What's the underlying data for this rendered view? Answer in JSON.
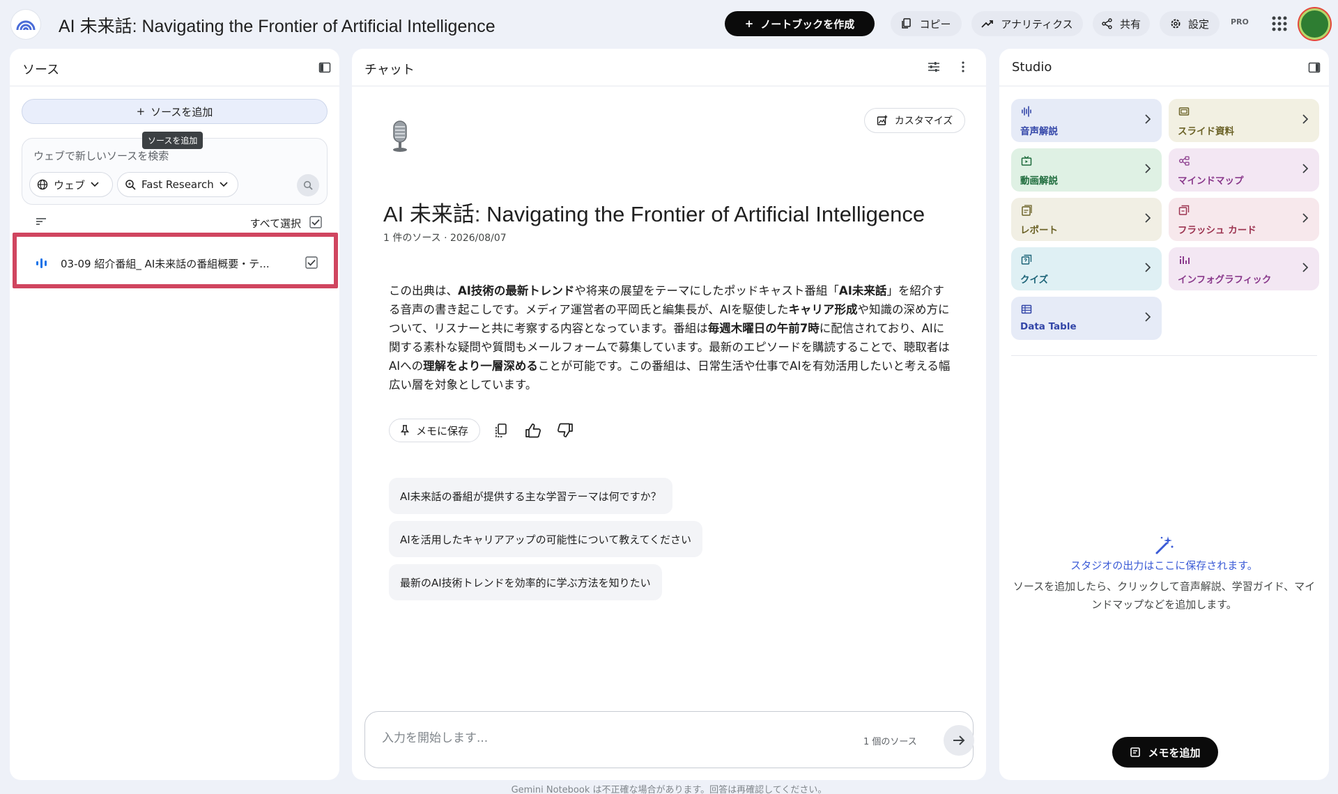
{
  "header": {
    "title": "AI 未来話: Navigating the Frontier of Artificial Intelligence",
    "create_notebook": "ノートブックを作成",
    "copy": "コピー",
    "analytics": "アナリティクス",
    "share": "共有",
    "settings": "設定",
    "plan_badge": "PRO"
  },
  "sources": {
    "title": "ソース",
    "add_source": "ソースを追加",
    "tooltip": "ソースを追加",
    "search_placeholder": "ウェブで新しいソースを検索",
    "web_chip": "ウェブ",
    "research_chip": "Fast Research",
    "select_all": "すべて選択",
    "items": [
      {
        "name": "03-09 紹介番組_ AI未来話の番組概要・テ...",
        "checked": true
      }
    ]
  },
  "chat": {
    "title": "チャット",
    "customize": "カスタマイズ",
    "notebook_title": "AI 未来話: Navigating the Frontier of Artificial Intelligence",
    "meta": "1 件のソース · 2026/08/07",
    "summary_parts": [
      {
        "text": "この出典は、",
        "bold": false
      },
      {
        "text": "AI技術の最新トレンド",
        "bold": true
      },
      {
        "text": "や将来の展望をテーマにしたポッドキャスト番組「",
        "bold": false
      },
      {
        "text": "AI未来話",
        "bold": true
      },
      {
        "text": "」を紹介する音声の書き起こしです。メディア運営者の平岡氏と編集長が、AIを駆使した",
        "bold": false
      },
      {
        "text": "キャリア形成",
        "bold": true
      },
      {
        "text": "や知識の深め方について、リスナーと共に考察する内容となっています。番組は",
        "bold": false
      },
      {
        "text": "毎週木曜日の午前7時",
        "bold": true
      },
      {
        "text": "に配信されており、AIに関する素朴な疑問や質問もメールフォームで募集しています。最新のエピソードを購読することで、聴取者はAIへの",
        "bold": false
      },
      {
        "text": "理解をより一層深める",
        "bold": true
      },
      {
        "text": "ことが可能です。この番組は、日常生活や仕事でAIを有効活用したいと考える幅広い層を対象としています。",
        "bold": false
      }
    ],
    "save_to_memo": "メモに保存",
    "suggestions": [
      "AI未来話の番組が提供する主な学習テーマは何ですか？",
      "AIを活用したキャリアアップの可能性について教えてください",
      "最新のAI技術トレンドを効率的に学ぶ方法を知りたい"
    ],
    "input_placeholder": "入力を開始します...",
    "source_count": "1 個のソース",
    "footer": "Gemini Notebook は不正確な場合があります。回答は再確認してください。"
  },
  "studio": {
    "title": "Studio",
    "tiles": [
      {
        "label": "音声解説",
        "icon": "audio-wave-icon",
        "bg": "#e6ebf7",
        "color": "#3346a8"
      },
      {
        "label": "スライド資料",
        "icon": "slides-icon",
        "bg": "#f2f0e2",
        "color": "#6b6227"
      },
      {
        "label": "動画解説",
        "icon": "video-icon",
        "bg": "#dff1e4",
        "color": "#1e6b3c"
      },
      {
        "label": "マインドマップ",
        "icon": "mindmap-icon",
        "bg": "#f3e7f3",
        "color": "#8a3a8c"
      },
      {
        "label": "レポート",
        "icon": "report-icon",
        "bg": "#f1efe4",
        "color": "#6b6227"
      },
      {
        "label": "フラッシュ カード",
        "icon": "flashcard-icon",
        "bg": "#f7e8ec",
        "color": "#9c3350"
      },
      {
        "label": "クイズ",
        "icon": "quiz-icon",
        "bg": "#dff0f4",
        "color": "#1d6478"
      },
      {
        "label": "インフォグラフィック",
        "icon": "infographic-icon",
        "bg": "#f3e7f3",
        "color": "#8a3a8c"
      },
      {
        "label": "Data Table",
        "icon": "table-icon",
        "bg": "#e6ebf7",
        "color": "#3346a8"
      }
    ],
    "empty_title": "スタジオの出力はここに保存されます。",
    "empty_desc": "ソースを追加したら、クリックして音声解説、学習ガイド、マインドマップなどを追加します。",
    "add_memo": "メモを追加"
  }
}
